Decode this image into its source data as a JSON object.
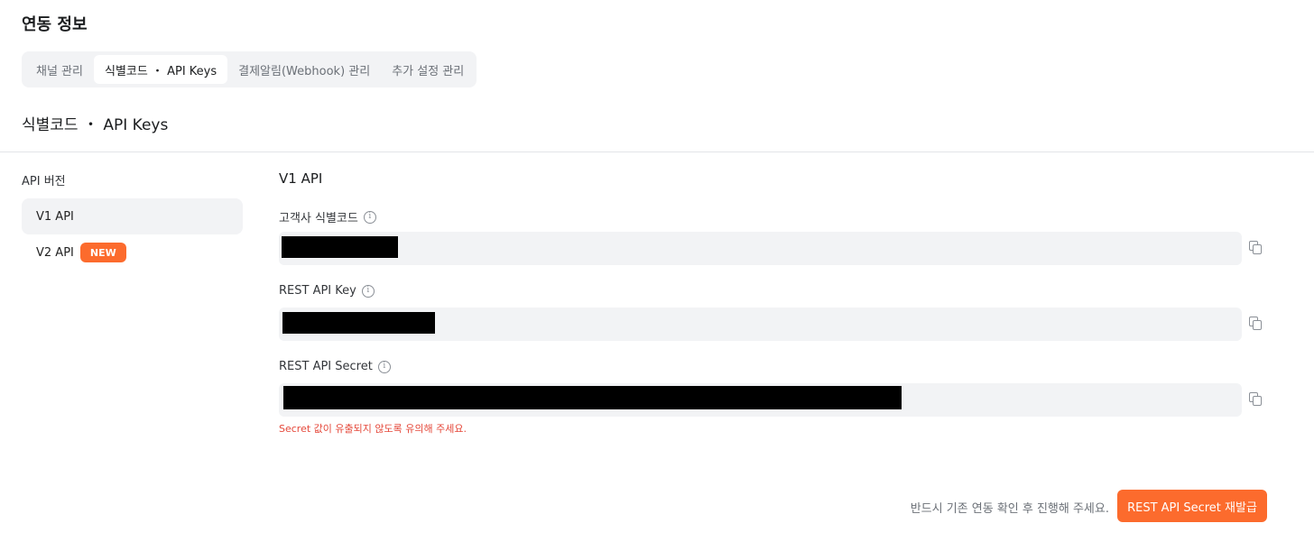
{
  "page_title": "연동 정보",
  "tabs": [
    {
      "label": "채널 관리",
      "active": false
    },
    {
      "label": "식별코드 ・ API Keys",
      "active": true
    },
    {
      "label": "결제알림(Webhook) 관리",
      "active": false
    },
    {
      "label": "추가 설정 관리",
      "active": false
    }
  ],
  "section_title": "식별코드 ・ API Keys",
  "sidebar": {
    "label": "API 버전",
    "items": [
      {
        "label": "V1 API",
        "active": true
      },
      {
        "label": "V2 API",
        "badge": "NEW",
        "active": false
      }
    ]
  },
  "main": {
    "heading": "V1 API",
    "fields": [
      {
        "label": "고객사 식별코드",
        "value": "[redacted]"
      },
      {
        "label": "REST API Key",
        "value": "[redacted]"
      },
      {
        "label": "REST API Secret",
        "value": "[redacted]"
      }
    ],
    "warning": "Secret 값이 유출되지 않도록 유의해 주세요."
  },
  "footer": {
    "note": "반드시 기존 연동 확인 후 진행해 주세요.",
    "button_label": "REST API Secret 재발급"
  },
  "colors": {
    "accent": "#fc6b2d",
    "warning": "#e5483a",
    "field_background": "#f2f3f5"
  }
}
